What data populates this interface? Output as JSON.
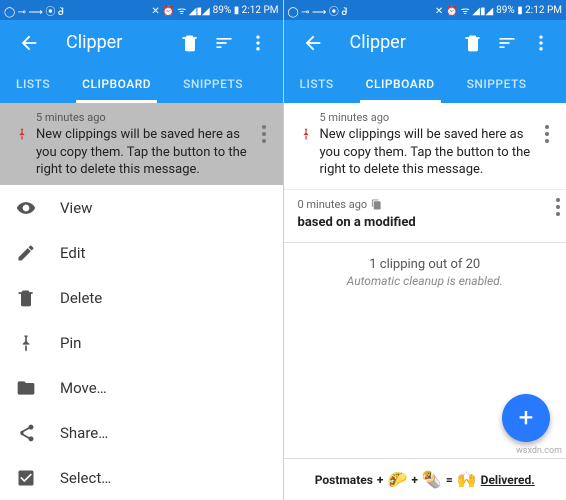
{
  "status": {
    "left_icons": "◯ ⊸ ⟶ ⦿ ᑯ̀",
    "right_text": "89% ▮ 2:12 PM",
    "right_icons": "✕ ⏰ ᯤ ◢▮◢"
  },
  "appbar": {
    "title": "Clipper"
  },
  "tabs": {
    "lists": "LISTS",
    "clipboard": "CLIPBOARD",
    "snippets": "SNIPPETS"
  },
  "pinned_item": {
    "timestamp": "5 minutes ago",
    "body": "New clippings will be saved here as you copy them. Tap the button to the right to delete this message."
  },
  "item": {
    "timestamp": "0 minutes ago",
    "body": "based on a modified"
  },
  "context_menu": {
    "view": "View",
    "edit": "Edit",
    "delete": "Delete",
    "pin": "Pin",
    "move": "Move…",
    "share": "Share…",
    "select": "Select…"
  },
  "summary": {
    "line1": "1 clipping out of 20",
    "line2": "Automatic cleanup is enabled."
  },
  "ad": {
    "brand": "Postmates",
    "plus": "+",
    "eq": "=",
    "delivered": "Delivered."
  },
  "watermark": "wsxdn.com"
}
